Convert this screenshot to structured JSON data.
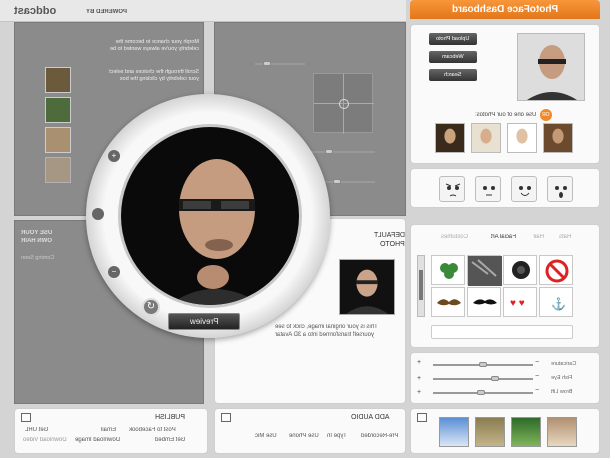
{
  "header": {
    "brand": "oddcast",
    "powered_by": "POWERED BY",
    "dashboard_title": "PhotoFace Dashboard"
  },
  "photo_panel": {
    "upload_label": "Upload Photo",
    "webcam_label": "Webcam",
    "search_label": "Search",
    "or_label": "OR",
    "use_one_label": "Use one of our Photos:"
  },
  "emotions": [
    "angry",
    "neutral",
    "happy",
    "surprised"
  ],
  "accessories": {
    "tabs": [
      "Hats",
      "Hair",
      "Facial Art",
      "Costumes"
    ],
    "active_tab": "Facial Art",
    "items": [
      "shamrock",
      "tiger-stripes",
      "rose",
      "prohibition-sign",
      "mustache",
      "mustache",
      "hearts",
      "anchor"
    ]
  },
  "sliders": {
    "labels": [
      "Caricature",
      "Fish Eye",
      "Brow Lift"
    ]
  },
  "default_photo": {
    "heading_line1": "DEFAULT",
    "heading_line2": "PHOTO",
    "description": "This is your original image, click to see yourself transformed into a 3D Avatar"
  },
  "publish": {
    "heading": "PUBLISH",
    "links": [
      "Post to Facebook",
      "Email",
      "Get URL",
      "Get Embed",
      "Download Image",
      "Download Video"
    ]
  },
  "audio": {
    "heading": "ADD AUDIO",
    "links": [
      "Pre-Recorded",
      "Type In",
      "Use Phone",
      "Use Mic"
    ]
  },
  "left_panels": {
    "celebrity_text": "Morph your chance to become the celebrity you've always wanted to be",
    "scroll_text": "Scroll through the choices and select your celebrity by clicking the box",
    "hair_line1": "USE YOUR",
    "hair_line2": "OWN HAIR",
    "hair_sub": "Coming Soon"
  },
  "preview_label": "Preview",
  "colors": {
    "accent_orange": "#f08a28",
    "panel_dark": "#8b8b8b",
    "button_dark": "#333333"
  }
}
